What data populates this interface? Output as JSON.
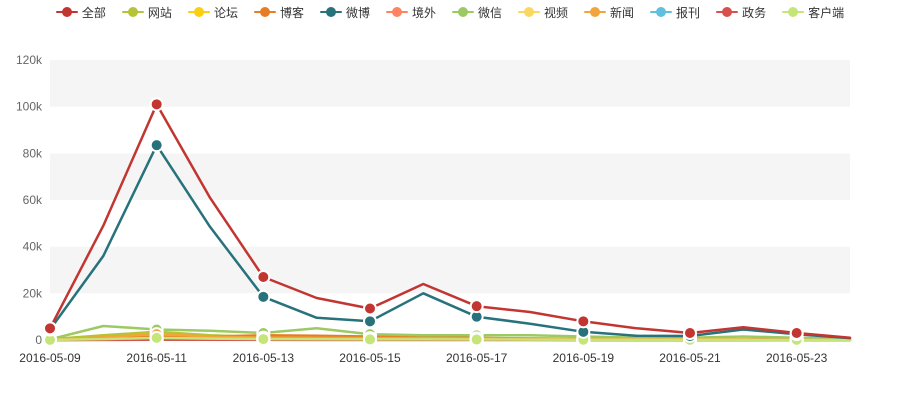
{
  "chart_data": {
    "type": "line",
    "title": "",
    "xlabel": "",
    "ylabel": "",
    "x": [
      "2016-05-09",
      "2016-05-10",
      "2016-05-11",
      "2016-05-12",
      "2016-05-13",
      "2016-05-14",
      "2016-05-15",
      "2016-05-16",
      "2016-05-17",
      "2016-05-18",
      "2016-05-19",
      "2016-05-20",
      "2016-05-21",
      "2016-05-22",
      "2016-05-23",
      "2016-05-24"
    ],
    "x_tick_labels": [
      "2016-05-09",
      "2016-05-11",
      "2016-05-13",
      "2016-05-15",
      "2016-05-17",
      "2016-05-19",
      "2016-05-21",
      "2016-05-23"
    ],
    "y_ticks": [
      0,
      20000,
      40000,
      60000,
      80000,
      100000,
      120000
    ],
    "y_tick_labels": [
      "0",
      "20k",
      "40k",
      "60k",
      "80k",
      "100k",
      "120k"
    ],
    "ylim": [
      0,
      120000
    ],
    "grid": "alternating horizontal bands",
    "legend_position": "top-center",
    "series": [
      {
        "name": "全部",
        "color": "#c23531",
        "values": [
          5000,
          49000,
          101000,
          61000,
          27000,
          18000,
          13500,
          24000,
          14500,
          12000,
          8000,
          5000,
          3000,
          5500,
          3000,
          1000
        ]
      },
      {
        "name": "网站",
        "color": "#b5c334",
        "values": [
          300,
          2000,
          3500,
          2000,
          1200,
          800,
          700,
          600,
          500,
          500,
          400,
          300,
          200,
          300,
          200,
          100
        ]
      },
      {
        "name": "论坛",
        "color": "#fcce10",
        "values": [
          100,
          1000,
          2500,
          1200,
          700,
          500,
          400,
          400,
          300,
          300,
          200,
          150,
          100,
          150,
          100,
          50
        ]
      },
      {
        "name": "博客",
        "color": "#e87c25",
        "values": [
          100,
          800,
          1500,
          1500,
          2000,
          1800,
          1500,
          1200,
          900,
          700,
          500,
          400,
          300,
          300,
          200,
          100
        ]
      },
      {
        "name": "微博",
        "color": "#27727b",
        "values": [
          4500,
          36000,
          83500,
          48500,
          18500,
          9500,
          8000,
          20000,
          10000,
          7000,
          3500,
          1800,
          1700,
          4500,
          2500,
          800
        ]
      },
      {
        "name": "境外",
        "color": "#fe8463",
        "values": [
          50,
          300,
          800,
          500,
          300,
          200,
          150,
          200,
          150,
          100,
          80,
          60,
          50,
          60,
          40,
          20
        ]
      },
      {
        "name": "微信",
        "color": "#9bca63",
        "values": [
          300,
          6000,
          4500,
          4000,
          3000,
          5000,
          2500,
          2000,
          2000,
          2000,
          1500,
          1000,
          1000,
          1500,
          1000,
          500
        ]
      },
      {
        "name": "视频",
        "color": "#fad860",
        "values": [
          20,
          100,
          200,
          150,
          100,
          80,
          60,
          60,
          50,
          40,
          30,
          20,
          20,
          20,
          10,
          10
        ]
      },
      {
        "name": "新闻",
        "color": "#f3a43b",
        "values": [
          100,
          1200,
          2500,
          1500,
          1000,
          900,
          800,
          800,
          700,
          600,
          500,
          400,
          300,
          300,
          200,
          100
        ]
      },
      {
        "name": "报刊",
        "color": "#60c0dd",
        "values": [
          10,
          50,
          100,
          80,
          60,
          50,
          40,
          40,
          30,
          30,
          20,
          20,
          10,
          10,
          10,
          5
        ]
      },
      {
        "name": "政务",
        "color": "#d7504b",
        "values": [
          10,
          50,
          150,
          100,
          80,
          60,
          50,
          50,
          40,
          30,
          20,
          20,
          10,
          10,
          10,
          5
        ]
      },
      {
        "name": "客户端",
        "color": "#c6e579",
        "values": [
          50,
          400,
          900,
          600,
          400,
          300,
          250,
          250,
          200,
          150,
          120,
          100,
          80,
          100,
          60,
          30
        ]
      }
    ]
  }
}
